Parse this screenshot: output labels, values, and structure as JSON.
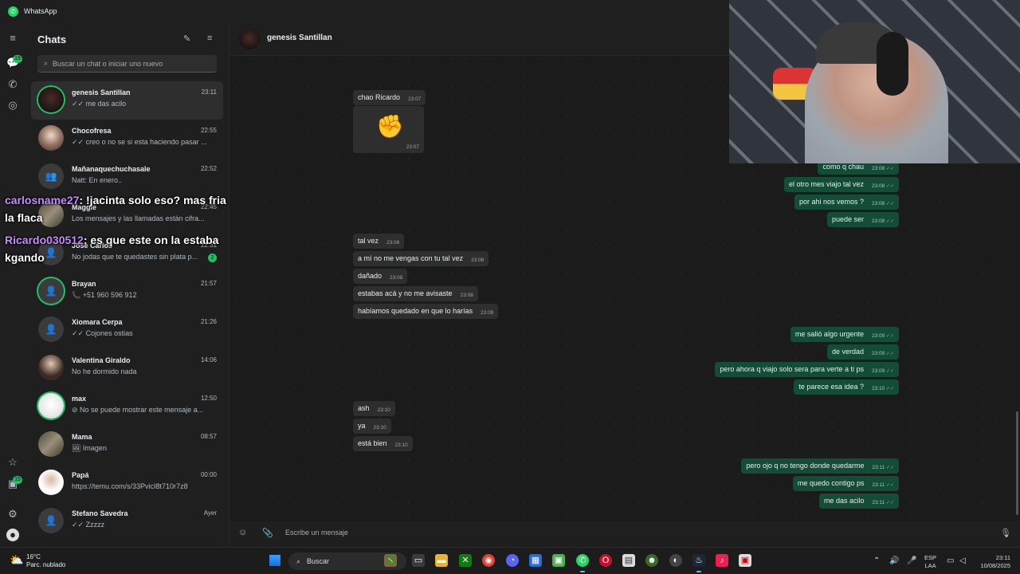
{
  "window": {
    "title": "WhatsApp"
  },
  "rail": {
    "chats_badge": "19",
    "updates_badge": "15"
  },
  "chat_list": {
    "title": "Chats",
    "search_placeholder": "Buscar un chat o iniciar uno nuevo",
    "items": [
      {
        "name": "genesis Santillan",
        "time": "23:11",
        "preview": "✓✓ me das acilo",
        "active": true
      },
      {
        "name": "Chocofresa",
        "time": "22:55",
        "preview": "✓✓ creo o no se si esta haciendo pasar ..."
      },
      {
        "name": "Mañanaquechuchasale",
        "time": "22:52",
        "preview": "Natt: En enero.."
      },
      {
        "name": "Maggie",
        "time": "22:45",
        "preview": "Los mensajes y las llamadas están cifra..."
      },
      {
        "name": "Jose Carlos",
        "time": "22:31",
        "preview": "No jodas que te quedastes sin plata p...",
        "badge": "2"
      },
      {
        "name": "Brayan",
        "time": "21:57",
        "preview": "📞 +51 960 596 912"
      },
      {
        "name": "Xiomara Cerpa",
        "time": "21:26",
        "preview": "✓✓ Cojones ostias"
      },
      {
        "name": "Valentina Giraldo",
        "time": "14:06",
        "preview": "No he dormido nada"
      },
      {
        "name": "max",
        "time": "12:50",
        "preview": "⊘ No se puede mostrar este mensaje a..."
      },
      {
        "name": "Mama",
        "time": "08:57",
        "preview": "🖼 Imagen"
      },
      {
        "name": "Papá",
        "time": "00:00",
        "preview": "https://temu.com/s/33PvicI8t710r7z8"
      },
      {
        "name": "Stefano Savedra",
        "time": "Ayer",
        "preview": "✓✓ Zzzzz"
      }
    ]
  },
  "stream_overlay": [
    {
      "user": "carlosname27",
      "text": ": !jacinta solo eso? mas fria la flaca"
    },
    {
      "user": "Ricardo030512",
      "text": ": es que este on la estaba kgando"
    }
  ],
  "conversation": {
    "contact": "genesis Santillan",
    "messages": [
      {
        "dir": "in",
        "text": "chao Ricardo",
        "time": "23:07"
      },
      {
        "dir": "in",
        "sticker": "✊",
        "time": "23:07"
      },
      {
        "dir": "out",
        "text": "como q chau",
        "time": "23:08"
      },
      {
        "dir": "out",
        "text": "el otro mes viajo tal vez",
        "time": "23:08"
      },
      {
        "dir": "out",
        "text": "por ahi nos vemos ?",
        "time": "23:08"
      },
      {
        "dir": "out",
        "text": "puede ser",
        "time": "23:08"
      },
      {
        "dir": "in",
        "text": "tal vez",
        "time": "23:08"
      },
      {
        "dir": "in",
        "text": "a mí no me vengas con tu tal vez",
        "time": "23:08"
      },
      {
        "dir": "in",
        "text": "dañado",
        "time": "23:08"
      },
      {
        "dir": "in",
        "text": "estabas acá y no me avisaste",
        "time": "23:08"
      },
      {
        "dir": "in",
        "text": "habíamos quedado en que lo harías",
        "time": "23:09"
      },
      {
        "dir": "out",
        "text": "me salió algo urgente",
        "time": "23:09"
      },
      {
        "dir": "out",
        "text": "de verdad",
        "time": "23:09"
      },
      {
        "dir": "out",
        "text": "pero ahora q viajo solo sera para verte a ti ps",
        "time": "23:09"
      },
      {
        "dir": "out",
        "text": "te parece esa idea ?",
        "time": "23:10"
      },
      {
        "dir": "in",
        "text": "ash",
        "time": "23:10"
      },
      {
        "dir": "in",
        "text": "ya",
        "time": "23:10"
      },
      {
        "dir": "in",
        "text": "está bien",
        "time": "23:10"
      },
      {
        "dir": "out",
        "text": "pero ojo q no tengo donde quedarme",
        "time": "23:11"
      },
      {
        "dir": "out",
        "text": "me quedo contigo ps",
        "time": "23:11"
      },
      {
        "dir": "out",
        "text": "me das acilo",
        "time": "23:11"
      }
    ],
    "composer_placeholder": "Escribe un mensaje"
  },
  "taskbar": {
    "weather_temp": "16°C",
    "weather_desc": "Parc. nublado",
    "search_label": "Buscar",
    "lang_line1": "ESP",
    "lang_line2": "LAA",
    "time": "23:11",
    "date": "10/08/2025"
  }
}
